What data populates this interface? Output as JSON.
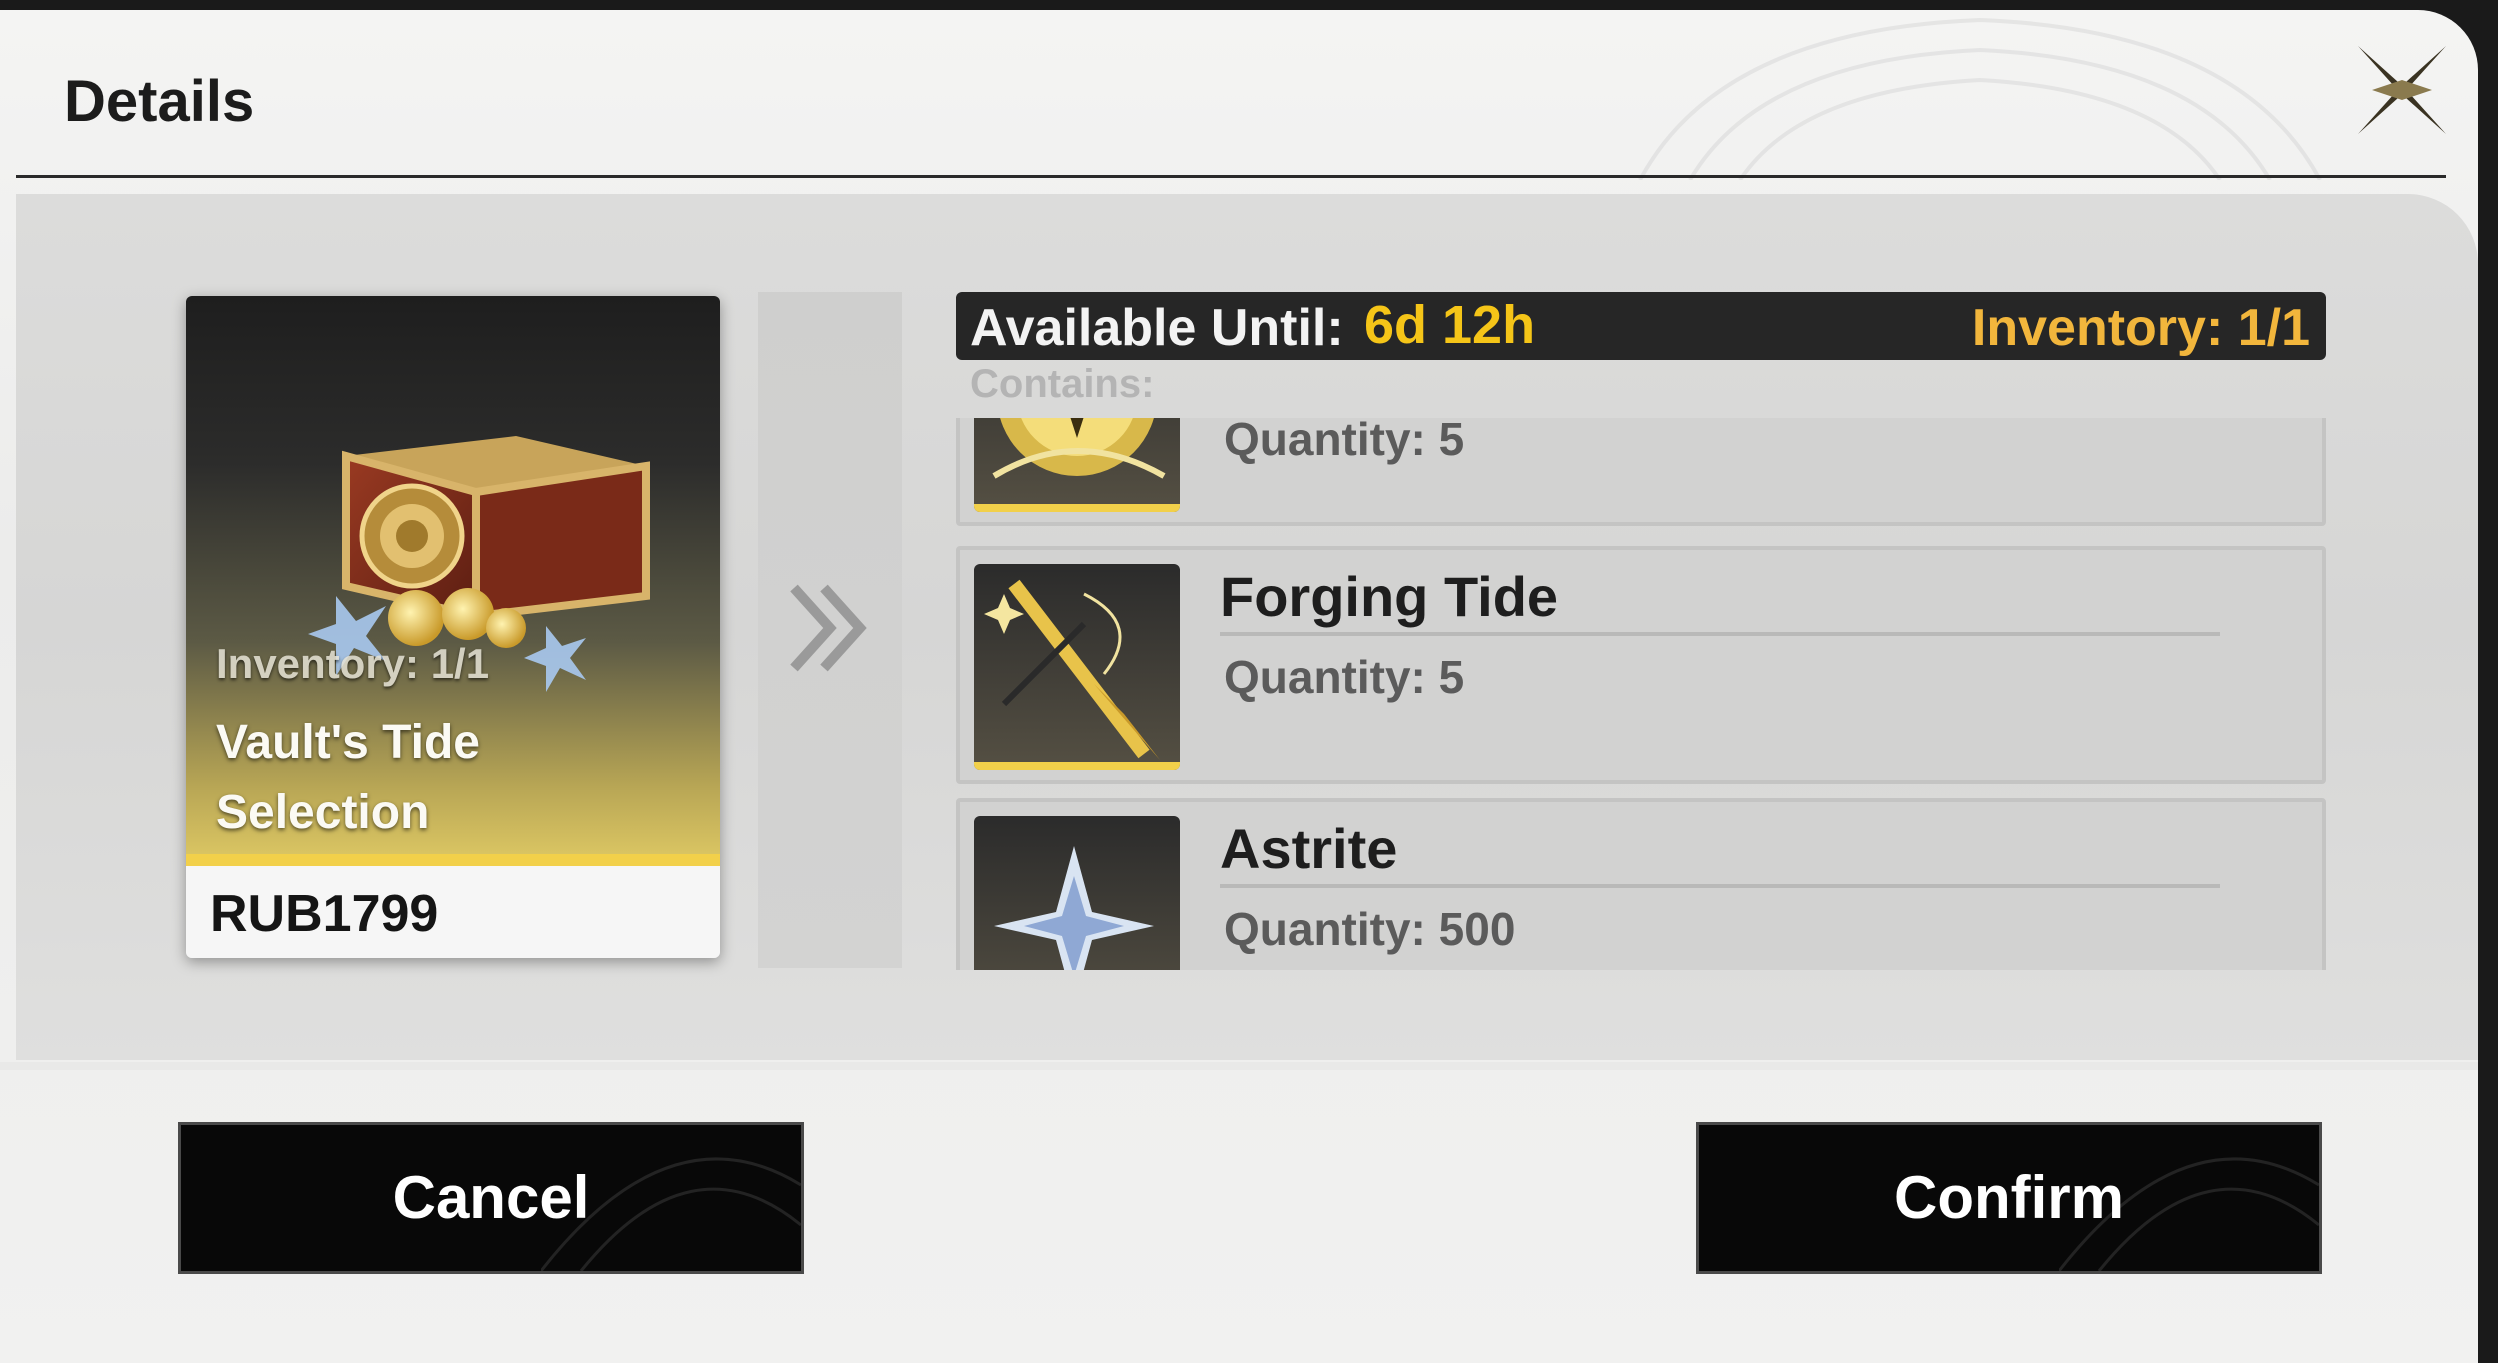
{
  "dialog": {
    "title": "Details"
  },
  "card": {
    "inventory": "Inventory: 1/1",
    "name": "Vault's Tide Selection",
    "price": "RUB1799"
  },
  "info": {
    "available_label": "Available Until:",
    "available_value": "6d 12h",
    "inventory": "Inventory: 1/1"
  },
  "contains_label": "Contains:",
  "items": [
    {
      "name": "",
      "quantity": "Quantity: 5",
      "icon": "gold-orb-icon"
    },
    {
      "name": "Forging Tide",
      "quantity": "Quantity: 5",
      "icon": "forging-tide-sword-icon"
    },
    {
      "name": "Astrite",
      "quantity": "Quantity: 500",
      "icon": "astrite-crystal-icon"
    }
  ],
  "buttons": {
    "cancel": "Cancel",
    "confirm": "Confirm"
  },
  "colors": {
    "accent_gold": "#f5c518",
    "inventory_gold": "#f2b63c",
    "card_highlight": "#f2d04a",
    "button_bg": "#080808"
  }
}
